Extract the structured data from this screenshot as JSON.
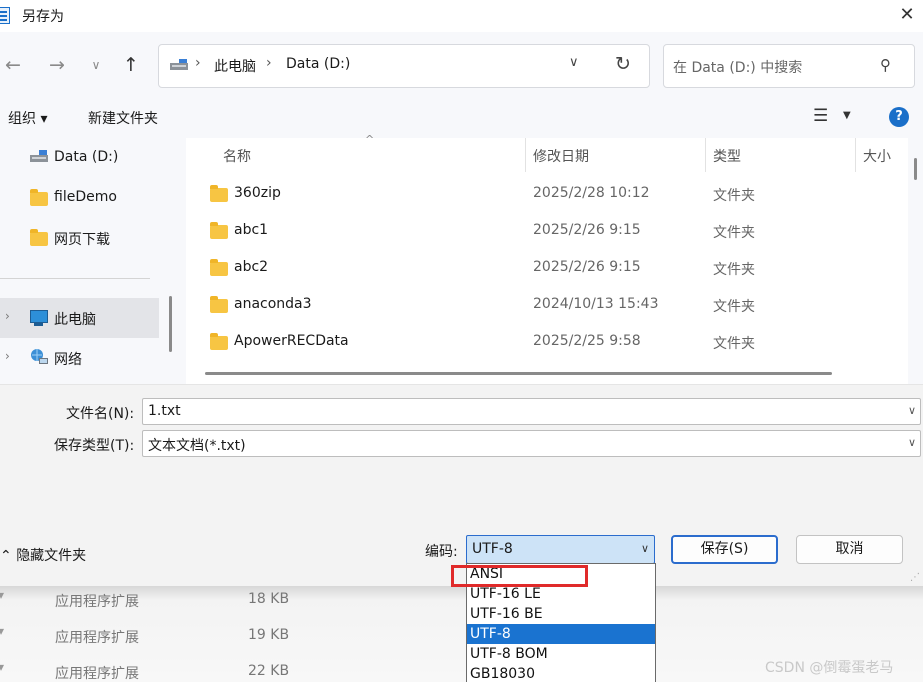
{
  "window": {
    "title": "另存为",
    "close": "✕"
  },
  "address": {
    "crumbs": [
      "此电脑",
      "Data (D:)"
    ],
    "search_placeholder": "在 Data (D:) 中搜索"
  },
  "toolbar": {
    "organize": "组织 ▾",
    "new_folder": "新建文件夹",
    "help": "?"
  },
  "nav": {
    "items": [
      {
        "label": "Data (D:)"
      },
      {
        "label": "fileDemo"
      },
      {
        "label": "网页下载"
      },
      {
        "label": "此电脑"
      },
      {
        "label": "网络"
      }
    ]
  },
  "file_list": {
    "columns": [
      "名称",
      "修改日期",
      "类型",
      "大小"
    ],
    "rows": [
      {
        "name": "360zip",
        "date": "2025/2/28 10:12",
        "type": "文件夹"
      },
      {
        "name": "abc1",
        "date": "2025/2/26 9:15",
        "type": "文件夹"
      },
      {
        "name": "abc2",
        "date": "2025/2/26 9:15",
        "type": "文件夹"
      },
      {
        "name": "anaconda3",
        "date": "2024/10/13 15:43",
        "type": "文件夹"
      },
      {
        "name": "ApowerRECData",
        "date": "2025/2/25 9:58",
        "type": "文件夹"
      }
    ]
  },
  "form": {
    "filename_label": "文件名(N):",
    "filename_value": "1.txt",
    "filetype_label": "保存类型(T):",
    "filetype_value": "文本文档(*.txt)",
    "hide_folders": "隐藏文件夹",
    "encoding_label": "编码:",
    "encoding_value": "UTF-8",
    "save": "保存(S)",
    "cancel": "取消"
  },
  "encoding_options": [
    "ANSI",
    "UTF-16 LE",
    "UTF-16 BE",
    "UTF-8",
    "UTF-8 BOM",
    "GB18030"
  ],
  "encoding_selected": "UTF-8",
  "background_rows": [
    {
      "type": "应用程序扩展",
      "size": "18 KB"
    },
    {
      "type": "应用程序扩展",
      "size": "19 KB"
    },
    {
      "type": "应用程序扩展",
      "size": "22 KB"
    }
  ],
  "watermark": "CSDN @倒霉蛋老马",
  "colors": {
    "accent": "#1a73d0",
    "highlight_box": "#e02a2a",
    "folder": "#f7c543"
  }
}
